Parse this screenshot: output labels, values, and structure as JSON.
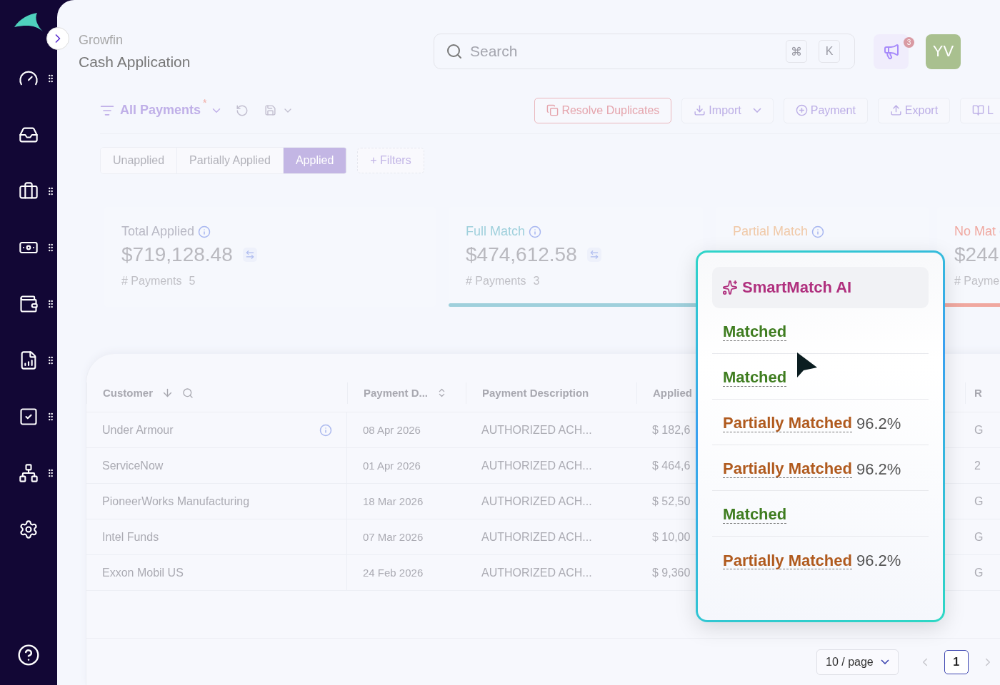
{
  "sidebar": {
    "items": [
      {
        "kind": "gauge",
        "handle": true
      },
      {
        "kind": "inbox",
        "handle": false
      },
      {
        "kind": "briefcase",
        "handle": true
      },
      {
        "kind": "exchange",
        "handle": true
      },
      {
        "kind": "atm",
        "handle": true
      },
      {
        "kind": "report",
        "handle": true
      },
      {
        "kind": "tray",
        "handle": true
      },
      {
        "kind": "network",
        "handle": true
      },
      {
        "kind": "settings",
        "handle": false
      }
    ]
  },
  "header": {
    "company": "Growfin",
    "title": "Cash Application",
    "search": {
      "placeholder": "Search",
      "keys": [
        "⌘",
        "K"
      ]
    },
    "notifications": "3",
    "avatar": "YV"
  },
  "toolbar": {
    "view": "All Payments",
    "modified_mark": "*",
    "actions": [
      {
        "kind": "danger",
        "label": "Resolve Duplicates",
        "dropdown": false
      },
      {
        "kind": "normal",
        "label": "Import",
        "dropdown": true
      },
      {
        "kind": "normal",
        "label": "Payment",
        "dropdown": false
      },
      {
        "kind": "normal",
        "label": "Export",
        "dropdown": false
      },
      {
        "kind": "normal",
        "label": "L",
        "dropdown": false
      }
    ]
  },
  "tabs": [
    {
      "label": "Unapplied",
      "selected": false
    },
    {
      "label": "Partially Applied",
      "selected": false
    },
    {
      "label": "Applied",
      "selected": true
    }
  ],
  "filters_button": "+ Filters",
  "summary_cards": [
    {
      "title": "Total Applied",
      "value": "$719,128.48",
      "count_label": "# Payments",
      "count": "5",
      "color": "#b8b8c4",
      "underlined": false
    },
    {
      "title": "Full Match",
      "value": "$474,612.58",
      "count_label": "# Payments",
      "count": "3",
      "color": "#9fd0dc",
      "underlined": true
    },
    {
      "title": "Partial Match",
      "color": "#f0c9a8"
    },
    {
      "title": "No Mat",
      "value": "$244",
      "count_label": "# Payme",
      "color": "#f0a8a0",
      "underlined": true
    }
  ],
  "table": {
    "columns": [
      "Customer",
      "Payment D...",
      "Payment Description",
      "Applied",
      "R"
    ],
    "rows": [
      {
        "cells": [
          "Under Armour",
          "08 Apr 2026",
          "AUTHORIZED ACH...",
          "$ 182,6",
          "G"
        ],
        "info": true
      },
      {
        "cells": [
          "ServiceNow",
          "01 Apr 2026",
          "AUTHORIZED ACH...",
          "$ 464,6",
          "2"
        ],
        "info": false
      },
      {
        "cells": [
          "PioneerWorks Manufacturing",
          "18 Mar 2026",
          "AUTHORIZED ACH...",
          "$ 52,50",
          "G"
        ],
        "info": false
      },
      {
        "cells": [
          "Intel Funds",
          "07 Mar 2026",
          "AUTHORIZED ACH...",
          "$ 10,00",
          "G"
        ],
        "info": false
      },
      {
        "cells": [
          "Exxon Mobil US",
          "24 Feb 2026",
          "AUTHORIZED ACH...",
          "$ 9,360",
          "G"
        ],
        "info": false
      }
    ]
  },
  "pagination": {
    "page_size": "10 / page",
    "pages": [
      {
        "label": "1",
        "selected": true
      }
    ]
  },
  "smartmatch": {
    "title": "SmartMatch AI",
    "rows": [
      {
        "kind": "matched",
        "label": "Matched"
      },
      {
        "kind": "matched",
        "label": "Matched"
      },
      {
        "kind": "partial",
        "label": "Partially Matched",
        "score": "96.2%"
      },
      {
        "kind": "partial",
        "label": "Partially Matched",
        "score": "96.2%"
      },
      {
        "kind": "matched",
        "label": "Matched"
      },
      {
        "kind": "partial",
        "label": "Partially Matched",
        "score": "96.2%"
      }
    ]
  }
}
